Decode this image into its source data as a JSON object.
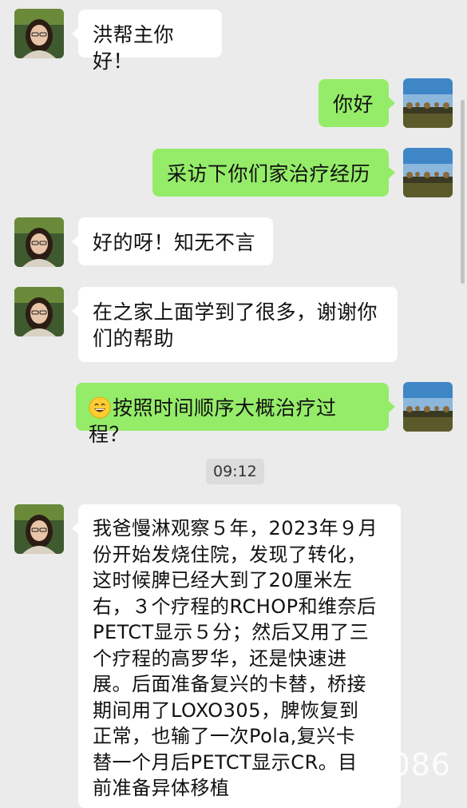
{
  "messages": [
    {
      "side": "in",
      "text": "洪帮主你好！"
    },
    {
      "side": "out",
      "text": "你好"
    },
    {
      "side": "out",
      "text": "采访下你们家治疗经历"
    },
    {
      "side": "in",
      "text": "好的呀！知无不言"
    },
    {
      "side": "in",
      "lines": [
        "在之家上面学到了很多，谢谢你",
        "们的帮助"
      ]
    },
    {
      "side": "out",
      "emoji": "grinning-face-emoji",
      "text": "按照时间顺序大概治疗过程？"
    },
    {
      "side": "in",
      "lines": [
        "我爸慢淋观察５年，2023年９月",
        "份开始发烧住院，发现了转化，",
        "这时候脾已经大到了20厘米左",
        "右，３个疗程的RCHOP和维奈后",
        "PETCT显示５分；然后又用了三",
        "个疗程的高罗华，还是快速进",
        "展。后面准备复兴的卡替，桥接",
        "期间用了LOXO305，脾恢复到",
        "正常，也输了一次Pola,复兴卡",
        "替一个月后PETCT显示CR。目",
        "前准备异体移植"
      ]
    }
  ],
  "timestamp": "09:12",
  "watermark": "086",
  "colors": {
    "background": "#ebebeb",
    "incoming_bubble": "#ffffff",
    "outgoing_bubble": "#95ec69",
    "time_pill": "#dcdcdc"
  },
  "icons": {
    "contact_avatar": "woman-with-glasses-avatar",
    "own_avatar": "landscape-trees-avatar"
  }
}
